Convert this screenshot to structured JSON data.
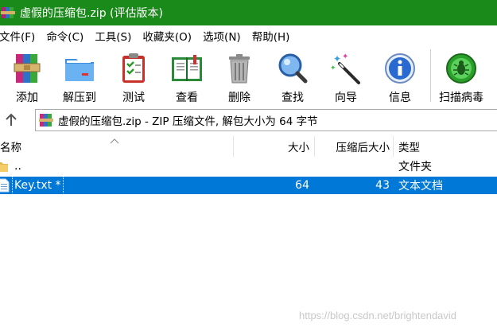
{
  "window": {
    "title": "虚假的压缩包.zip (评估版本)",
    "app_icon": "winrar-books-icon"
  },
  "menu": [
    "文件(F)",
    "命令(C)",
    "工具(S)",
    "收藏夹(O)",
    "选项(N)",
    "帮助(H)"
  ],
  "toolbar": {
    "add": "添加",
    "extract": "解压到",
    "test": "测试",
    "view": "查看",
    "delete": "删除",
    "find": "查找",
    "wizard": "向导",
    "info": "信息",
    "scan": "扫描病毒"
  },
  "address": {
    "path": "虚假的压缩包.zip - ZIP 压缩文件, 解包大小为 64 字节"
  },
  "columns": {
    "name": "名称",
    "size": "大小",
    "packed": "压缩后大小",
    "type": "类型"
  },
  "rows": [
    {
      "name": "..",
      "size": "",
      "packed": "",
      "type": "文件夹",
      "icon": "folder-icon",
      "selected": false
    },
    {
      "name": "Key.txt *",
      "size": "64",
      "packed": "43",
      "type": "文本文档",
      "icon": "text-file-icon",
      "selected": true
    }
  ],
  "watermark": "https://blog.csdn.net/brightendavid",
  "colors": {
    "titlebar": "#1a8a1a",
    "selection": "#0078d7"
  }
}
